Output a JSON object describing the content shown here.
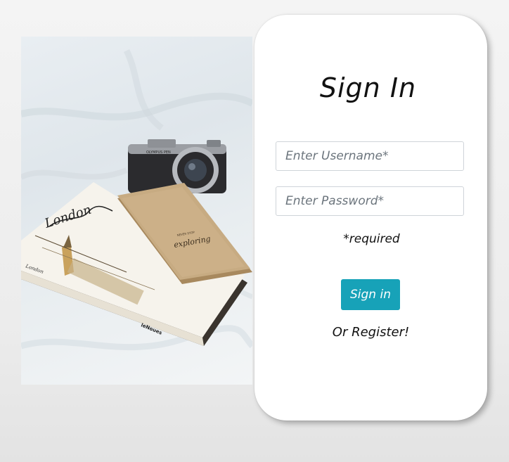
{
  "photo": {
    "notebook_text": "London",
    "book_spine_text": "London",
    "book_brand": "leNoues",
    "camera_brand": "OLYMPUS PEN",
    "passport_small_text": "NEVER STOP",
    "passport_script_text": "exploring"
  },
  "form": {
    "title": "Sign In",
    "username_placeholder": "Enter Username*",
    "password_placeholder": "Enter Password*",
    "required_note": "*required",
    "signin_label": "Sign in",
    "register_label": "Or Register!"
  },
  "colors": {
    "button_bg": "#17a2b8",
    "card_bg": "#ffffff"
  }
}
